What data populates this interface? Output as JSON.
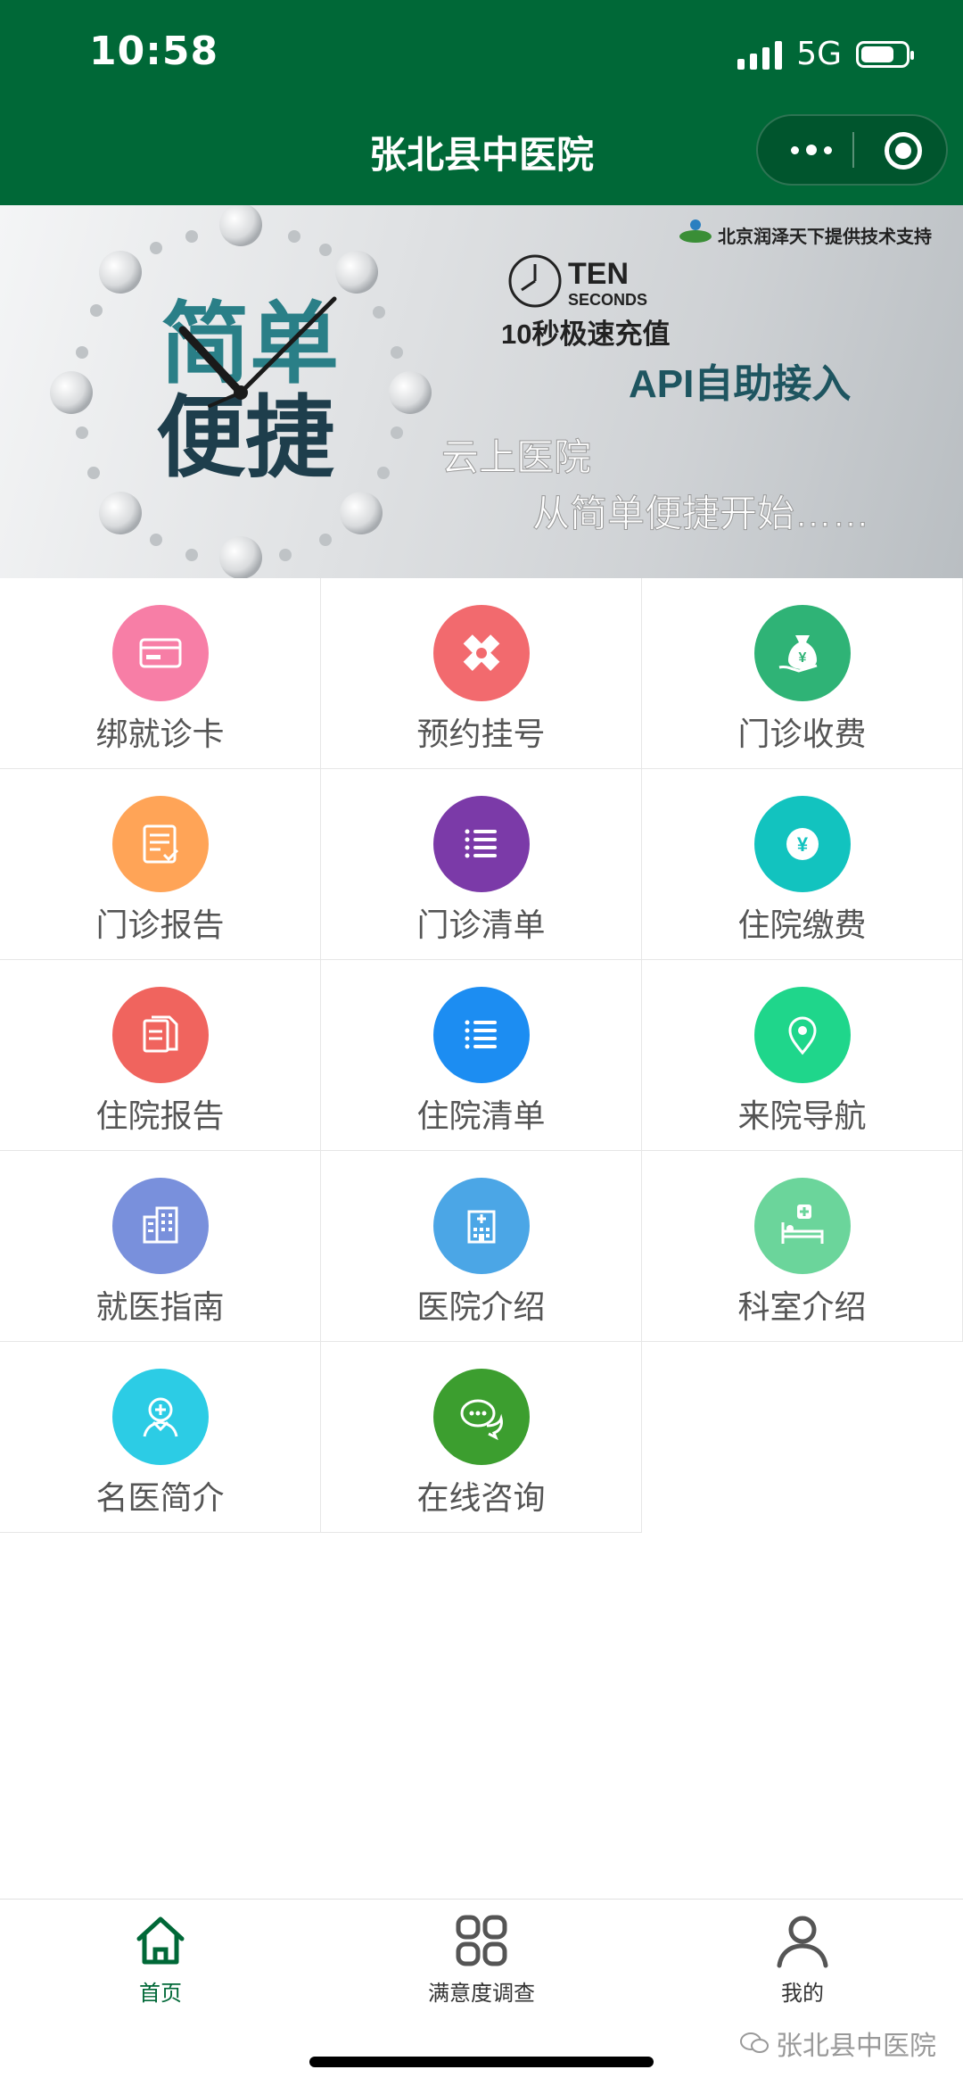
{
  "status_bar": {
    "time": "10:58",
    "network": "5G",
    "battery_level": 0.8
  },
  "nav": {
    "title": "张北县中医院"
  },
  "banner": {
    "watermark_text": "北京润泽天下提供技术支持",
    "ten": "TEN",
    "seconds": "SECONDS",
    "recharge": "10秒极速充值",
    "api": "API自助接入",
    "big_line1": "简单",
    "big_line2": "便捷",
    "cloud": "云上医院",
    "slogan": "从简单便捷开始……"
  },
  "menu": [
    {
      "label": "绑就诊卡",
      "color": "#f77ea6",
      "icon": "card-icon"
    },
    {
      "label": "预约挂号",
      "color": "#f26a6e",
      "icon": "medical-cross-icon"
    },
    {
      "label": "门诊收费",
      "color": "#2fb376",
      "icon": "money-bag-icon"
    },
    {
      "label": "门诊报告",
      "color": "#ffa457",
      "icon": "report-check-icon"
    },
    {
      "label": "门诊清单",
      "color": "#7b3aa8",
      "icon": "list-icon"
    },
    {
      "label": "住院缴费",
      "color": "#12c3bf",
      "icon": "yuan-coin-icon"
    },
    {
      "label": "住院报告",
      "color": "#f0645e",
      "icon": "documents-icon"
    },
    {
      "label": "住院清单",
      "color": "#1c8df2",
      "icon": "list-icon"
    },
    {
      "label": "来院导航",
      "color": "#1fd68b",
      "icon": "location-pin-icon"
    },
    {
      "label": "就医指南",
      "color": "#7990dc",
      "icon": "building-icon"
    },
    {
      "label": "医院介绍",
      "color": "#4ba6e6",
      "icon": "hospital-icon"
    },
    {
      "label": "科室介绍",
      "color": "#6bd59b",
      "icon": "hospital-bed-icon"
    },
    {
      "label": "名医简介",
      "color": "#2ccce5",
      "icon": "doctor-icon"
    },
    {
      "label": "在线咨询",
      "color": "#3c9e2f",
      "icon": "chat-icon"
    }
  ],
  "tabbar": [
    {
      "label": "首页",
      "icon": "home-icon",
      "active": true
    },
    {
      "label": "满意度调查",
      "icon": "grid-icon",
      "active": false
    },
    {
      "label": "我的",
      "icon": "user-icon",
      "active": false
    }
  ],
  "watermark": {
    "text": "张北县中医院"
  },
  "colors": {
    "header": "#006837",
    "active_tab": "#006837"
  }
}
